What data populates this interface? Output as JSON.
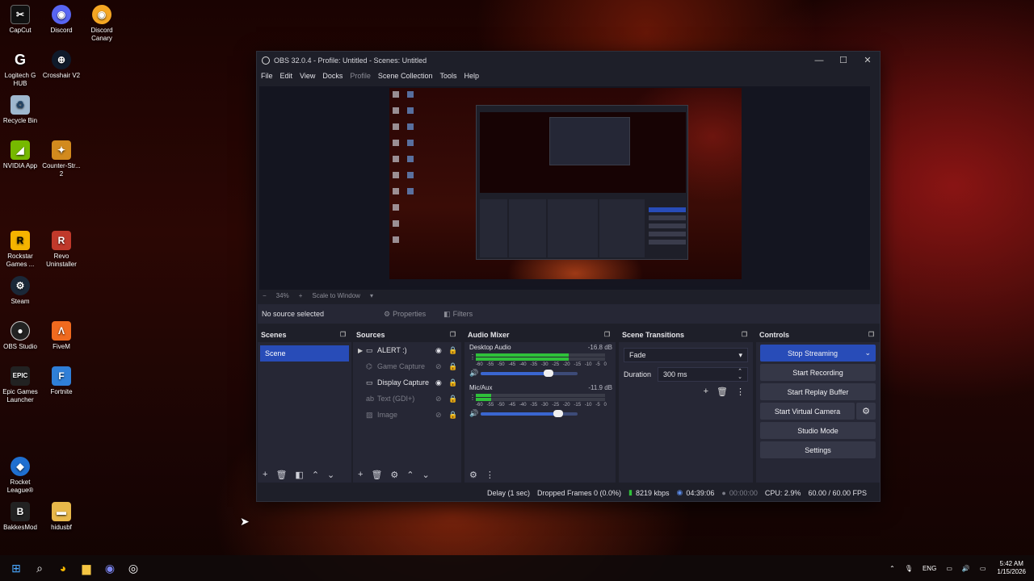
{
  "desktop": {
    "icons": [
      {
        "label": "CapCut"
      },
      {
        "label": "Discord"
      },
      {
        "label": "Discord Canary"
      },
      {
        "label": "Logitech G HUB"
      },
      {
        "label": "Crosshair V2"
      },
      {
        "label": "Recycle Bin"
      },
      {
        "label": "NVIDIA App"
      },
      {
        "label": "Counter-Str... 2"
      },
      {
        "label": "Rockstar Games ..."
      },
      {
        "label": "Revo Uninstaller"
      },
      {
        "label": "Steam"
      },
      {
        "label": "OBS Studio"
      },
      {
        "label": "FiveM"
      },
      {
        "label": "Epic Games Launcher"
      },
      {
        "label": "Fortnite"
      },
      {
        "label": "Rocket League®"
      },
      {
        "label": "BakkesMod"
      },
      {
        "label": "hidusbf"
      }
    ]
  },
  "obs": {
    "title": "OBS 32.0.4 - Profile: Untitled - Scenes: Untitled",
    "menu": [
      "File",
      "Edit",
      "View",
      "Docks",
      "Profile",
      "Scene Collection",
      "Tools",
      "Help"
    ],
    "zoom": {
      "minus": "−",
      "value": "34%",
      "plus": "+",
      "mode": "Scale to Window",
      "mode_arrow": "▾"
    },
    "source_bar": {
      "no_source": "No source selected",
      "properties": "Properties",
      "filters": "Filters"
    },
    "scenes": {
      "title": "Scenes",
      "items": [
        "Scene"
      ]
    },
    "sources": {
      "title": "Sources",
      "items": [
        {
          "name": "ALERT :)",
          "visible": true
        },
        {
          "name": "Game Capture",
          "visible": false
        },
        {
          "name": "Display Capture",
          "visible": true
        },
        {
          "name": "Text (GDI+)",
          "visible": false
        },
        {
          "name": "Image",
          "visible": false
        }
      ]
    },
    "mixer": {
      "title": "Audio Mixer",
      "scale": [
        "-60",
        "-55",
        "-50",
        "-45",
        "-40",
        "-35",
        "-30",
        "-25",
        "-20",
        "-15",
        "-10",
        "-5",
        "0"
      ],
      "channels": [
        {
          "name": "Desktop Audio",
          "db": "-16.8 dB",
          "level": 0.72,
          "volume": 0.7
        },
        {
          "name": "Mic/Aux",
          "db": "-11.9 dB",
          "level": 0.12,
          "volume": 0.8
        }
      ]
    },
    "transitions": {
      "title": "Scene Transitions",
      "type": "Fade",
      "duration_label": "Duration",
      "duration": "300 ms"
    },
    "controls": {
      "title": "Controls",
      "stop_streaming": "Stop Streaming",
      "start_recording": "Start Recording",
      "start_replay": "Start Replay Buffer",
      "start_virtual_camera": "Start Virtual Camera",
      "studio_mode": "Studio Mode",
      "settings": "Settings"
    },
    "status": {
      "delay": "Delay (1 sec)",
      "dropped": "Dropped Frames 0 (0.0%)",
      "kbps": "8219 kbps",
      "stream_time": "04:39:06",
      "rec_time": "00:00:00",
      "cpu": "CPU: 2.9%",
      "fps": "60.00 / 60.00 FPS"
    }
  },
  "taskbar": {
    "lang": "ENG",
    "time": "5:42 AM",
    "date": "1/15/2026"
  },
  "colors": {
    "accent": "#284cb8",
    "meter_green": "#2fc13a",
    "meter_yellow": "#c8b62b",
    "meter_red": "#c0392b"
  }
}
